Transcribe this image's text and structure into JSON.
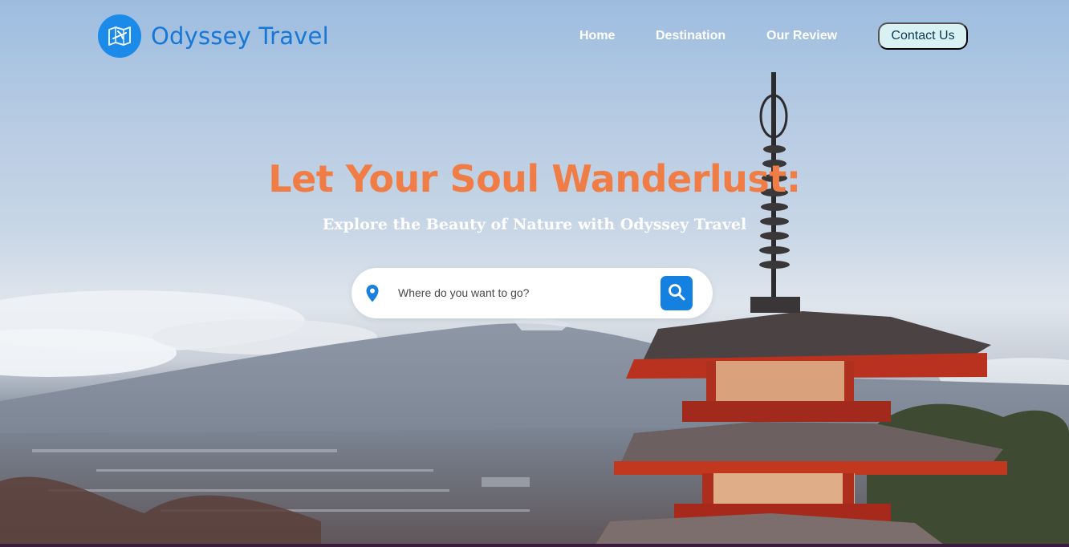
{
  "brand": {
    "name": "Odyssey Travel",
    "icon": "map-plane-icon"
  },
  "nav": {
    "items": [
      {
        "label": "Home"
      },
      {
        "label": "Destination"
      },
      {
        "label": "Our Review"
      }
    ],
    "contact_label": "Contact Us"
  },
  "hero": {
    "title": "Let Your Soul Wanderlust:",
    "subtitle": "Explore the Beauty of Nature with Odyssey Travel",
    "background": "pagoda-mountain-photo"
  },
  "search": {
    "placeholder": "Where do you want to go?",
    "value": "",
    "leading_icon": "location-pin-icon",
    "button_icon": "search-icon"
  },
  "colors": {
    "brand_blue": "#1677d6",
    "title_orange": "#f07d45",
    "button_blue": "#1481e0",
    "contact_bg": "#d9f1f3"
  }
}
